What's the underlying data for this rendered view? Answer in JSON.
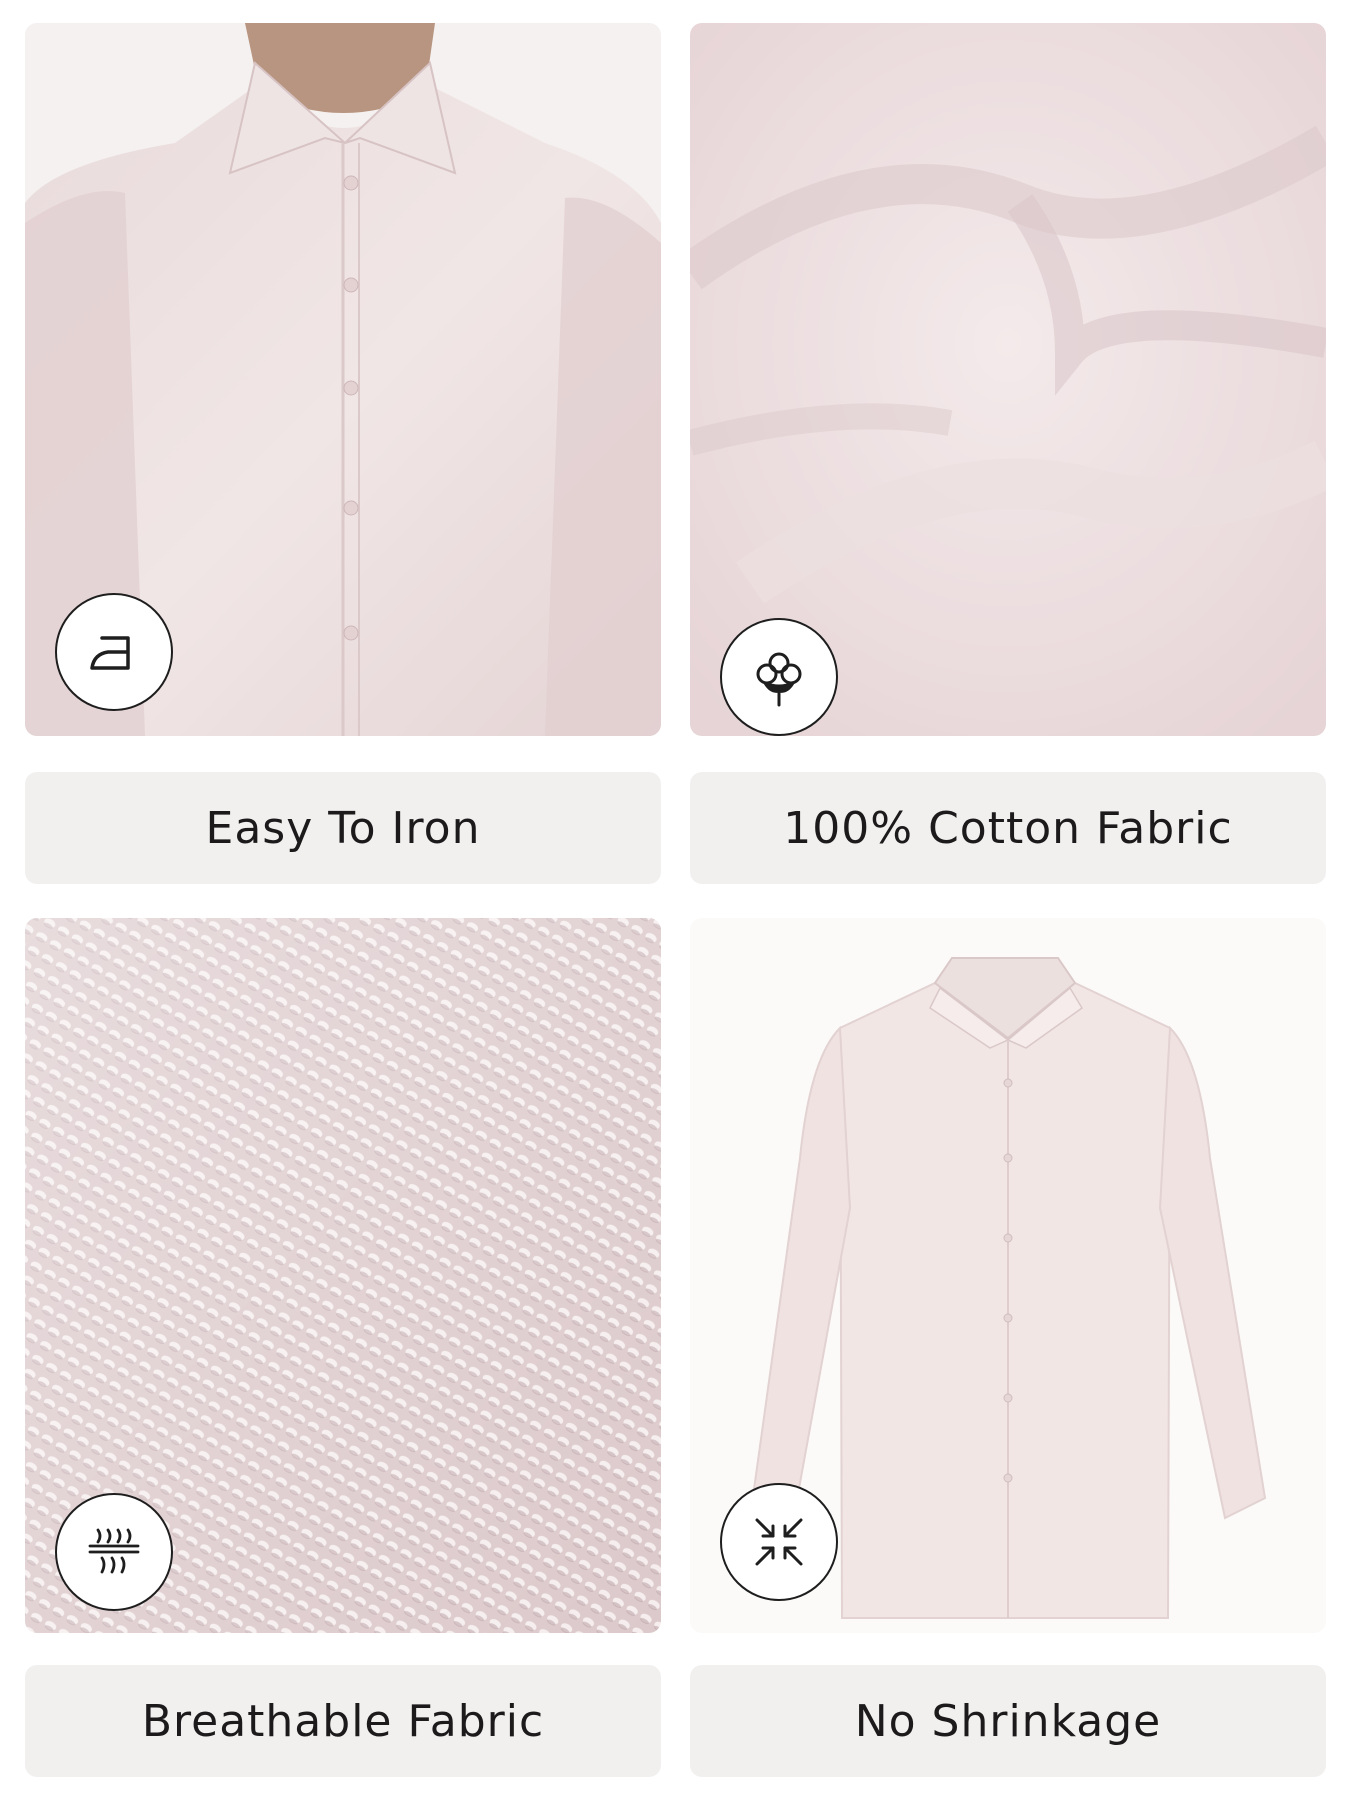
{
  "features": [
    {
      "label": "Easy To Iron",
      "icon": "iron-icon"
    },
    {
      "label": "100% Cotton Fabric",
      "icon": "cotton-flower-icon"
    },
    {
      "label": "Breathable Fabric",
      "icon": "breathable-fabric-icon"
    },
    {
      "label": "No Shrinkage",
      "icon": "no-shrinkage-icon"
    }
  ],
  "colors": {
    "shirt_pink": "#ecdcdc",
    "label_background": "#f2f0ef",
    "text": "#1c1a1a"
  }
}
